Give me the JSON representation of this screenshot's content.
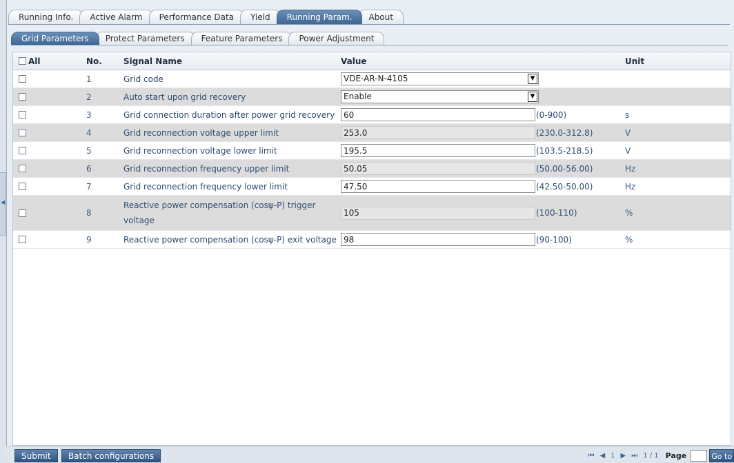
{
  "main_tabs": [
    "Running Info.",
    "Active Alarm",
    "Performance Data",
    "Yield",
    "Running Param.",
    "About"
  ],
  "active_main_tab": "Running Param.",
  "sub_tabs": [
    "Grid Parameters",
    "Protect Parameters",
    "Feature Parameters",
    "Power Adjustment"
  ],
  "active_sub_tab": "Grid Parameters",
  "table": {
    "headers": {
      "all": "All",
      "no": "No.",
      "signal": "Signal Name",
      "value": "Value",
      "unit": "Unit"
    },
    "rows": [
      {
        "no": "1",
        "name": "Grid code",
        "type": "select",
        "value": "VDE-AR-N-4105",
        "range": "",
        "unit": ""
      },
      {
        "no": "2",
        "name": "Auto start upon grid recovery",
        "type": "select",
        "value": "Enable",
        "range": "",
        "unit": ""
      },
      {
        "no": "3",
        "name": "Grid connection duration after power grid recovery",
        "type": "input",
        "value": "60",
        "range": "(0-900)",
        "unit": "s"
      },
      {
        "no": "4",
        "name": "Grid reconnection voltage upper limit",
        "type": "readonly",
        "value": "253.0",
        "range": "(230.0-312.8)",
        "unit": "V"
      },
      {
        "no": "5",
        "name": "Grid reconnection voltage lower limit",
        "type": "input",
        "value": "195.5",
        "range": "(103.5-218.5)",
        "unit": "V"
      },
      {
        "no": "6",
        "name": "Grid reconnection frequency upper limit",
        "type": "readonly",
        "value": "50.05",
        "range": "(50.00-56.00)",
        "unit": "Hz"
      },
      {
        "no": "7",
        "name": "Grid reconnection frequency lower limit",
        "type": "input",
        "value": "47.50",
        "range": "(42.50-50.00)",
        "unit": "Hz"
      },
      {
        "no": "8",
        "name": "Reactive power compensation (cosψ-P) trigger voltage",
        "type": "readonly",
        "value": "105",
        "range": "(100-110)",
        "unit": "%"
      },
      {
        "no": "9",
        "name": "Reactive power compensation (cosψ-P) exit voltage",
        "type": "input",
        "value": "98",
        "range": "(90-100)",
        "unit": "%"
      }
    ]
  },
  "footer": {
    "submit": "Submit",
    "batch": "Batch configurations",
    "page_display": "1",
    "page_of": "1 / 1",
    "page_label": "Page",
    "goto": "Go to"
  }
}
